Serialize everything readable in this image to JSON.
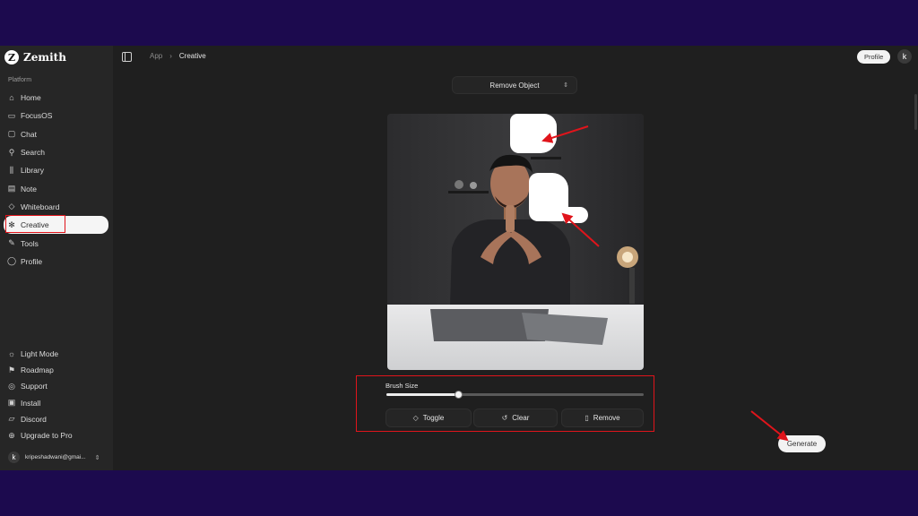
{
  "app": {
    "name": "Zemith",
    "logo_letter": "Z"
  },
  "sidebar": {
    "section_label": "Platform",
    "items": [
      {
        "label": "Home",
        "icon": "home-icon"
      },
      {
        "label": "FocusOS",
        "icon": "focus-icon"
      },
      {
        "label": "Chat",
        "icon": "chat-icon"
      },
      {
        "label": "Search",
        "icon": "search-icon"
      },
      {
        "label": "Library",
        "icon": "library-icon"
      },
      {
        "label": "Note",
        "icon": "note-icon"
      },
      {
        "label": "Whiteboard",
        "icon": "whiteboard-icon"
      },
      {
        "label": "Creative",
        "icon": "palette-icon",
        "active": true
      },
      {
        "label": "Tools",
        "icon": "wrench-icon"
      },
      {
        "label": "Profile",
        "icon": "user-icon"
      }
    ],
    "bottom_items": [
      {
        "label": "Light Mode",
        "icon": "sun-icon"
      },
      {
        "label": "Roadmap",
        "icon": "roadmap-icon"
      },
      {
        "label": "Support",
        "icon": "support-icon"
      },
      {
        "label": "Install",
        "icon": "install-icon"
      },
      {
        "label": "Discord",
        "icon": "discord-icon"
      },
      {
        "label": "Upgrade to Pro",
        "icon": "upgrade-icon"
      }
    ],
    "user": {
      "avatar_letter": "k",
      "email": "kripeshadwani@gmai..."
    }
  },
  "header": {
    "breadcrumb": [
      "App",
      "Creative"
    ],
    "profile_label": "Profile",
    "avatar_letter": "k"
  },
  "editor": {
    "mode": "Remove Object",
    "brush_label": "Brush Size",
    "brush_value": 0.28,
    "buttons": {
      "toggle": "Toggle",
      "clear": "Clear",
      "remove": "Remove"
    },
    "generate_label": "Generate"
  },
  "colors": {
    "accent_annotation": "#e0141b",
    "background": "#1f1f1f",
    "outer": "#1c0a4e"
  }
}
